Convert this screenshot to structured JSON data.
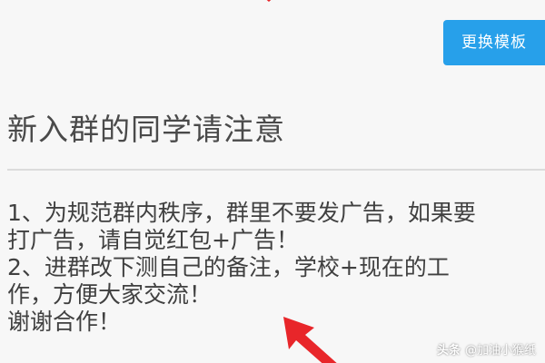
{
  "toolbar": {
    "change_template_label": "更换模板"
  },
  "notice": {
    "title": "新入群的同学请注意",
    "lines": [
      "1、为规范群内秩序，群里不要发广告，如果要",
      "打广告，请自觉红包+广告！",
      "2、进群改下测自己的备注，学校+现在的工",
      "作，方便大家交流！",
      "谢谢合作！"
    ]
  },
  "watermark": {
    "source": "头条",
    "author": "@加油小猴纸"
  },
  "colors": {
    "accent": "#27a0ea",
    "arrow": "#e8262a",
    "title": "#4a4a4a",
    "body": "#404040",
    "divider": "#dcdcdc"
  },
  "icons": {
    "top_arrow": "arrow-tip-icon",
    "pointer_arrow": "red-arrow-icon",
    "watermark": "at-icon"
  }
}
